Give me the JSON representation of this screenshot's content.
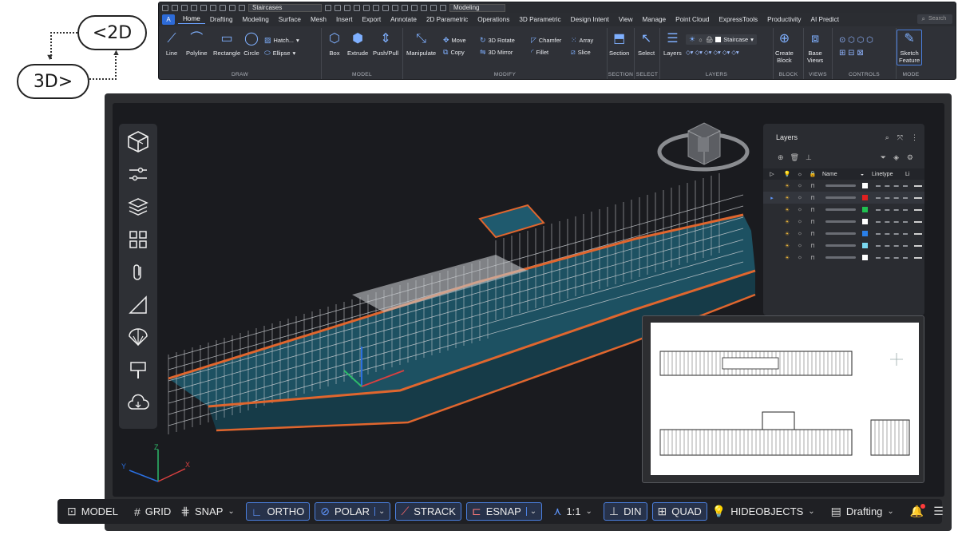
{
  "callouts": {
    "to2d": "<2D",
    "to3d": "3D>"
  },
  "qat": {
    "file_name": "Staircases",
    "workspace": "Modeling"
  },
  "menu": {
    "app": "A",
    "tabs": [
      "Home",
      "Drafting",
      "Modeling",
      "Surface",
      "Mesh",
      "Insert",
      "Export",
      "Annotate",
      "2D Parametric",
      "Operations",
      "3D Parametric",
      "Design Intent",
      "View",
      "Manage",
      "Point Cloud",
      "ExpressTools",
      "Productivity",
      "AI Predict"
    ],
    "active_tab": "Home",
    "search_placeholder": "Search"
  },
  "ribbon": {
    "draw": {
      "title": "DRAW",
      "line": "Line",
      "polyline": "Polyline",
      "rectangle": "Rectangle",
      "circle": "Circle",
      "hatch": "Hatch...",
      "ellipse": "Ellipse"
    },
    "model": {
      "title": "MODEL",
      "box": "Box",
      "extrude": "Extrude",
      "pushpull": "Push/Pull"
    },
    "modify": {
      "title": "MODIFY",
      "manipulate": "Manipulate",
      "move": "Move",
      "copy": "Copy",
      "rotate3d": "3D Rotate",
      "mirror3d": "3D Mirror",
      "chamfer": "Chamfer",
      "fillet": "Fillet",
      "array": "Array",
      "slice": "Slice"
    },
    "section": {
      "title": "SECTION",
      "label": "Section"
    },
    "select": {
      "title": "SELECT",
      "label": "Select"
    },
    "layers": {
      "title": "LAYERS",
      "label": "Layers",
      "current": "Staircase"
    },
    "block": {
      "title": "BLOCK",
      "create1": "Create",
      "create2": "Block"
    },
    "views": {
      "title": "VIEWS",
      "base1": "Base",
      "base2": "Views"
    },
    "controls": {
      "title": "CONTROLS"
    },
    "mode": {
      "title": "MODE",
      "sketch1": "Sketch",
      "sketch2": "Feature"
    }
  },
  "layers_panel": {
    "title": "Layers",
    "columns": {
      "name": "Name",
      "linetype": "Linetype",
      "lineweight": "Li"
    },
    "rows": [
      {
        "color": "#ffffff",
        "selected": false
      },
      {
        "color": "#e02020",
        "selected": true
      },
      {
        "color": "#20c050",
        "selected": false
      },
      {
        "color": "#ffffff",
        "selected": false
      },
      {
        "color": "#2a7fe8",
        "selected": false
      },
      {
        "color": "#7ad8f0",
        "selected": false
      },
      {
        "color": "#ffffff",
        "selected": false
      }
    ]
  },
  "axes": {
    "x": "X",
    "y": "Y",
    "z": "Z"
  },
  "status": {
    "model": "MODEL",
    "grid": "GRID",
    "snap": "SNAP",
    "ortho": "ORTHO",
    "polar": "POLAR",
    "strack": "STRACK",
    "esnap": "ESNAP",
    "scale": "1:1",
    "din": "DIN",
    "quad": "QUAD",
    "hideobjects": "HIDEOBJECTS",
    "workspace": "Drafting"
  },
  "colors": {
    "accent": "#4b80e0",
    "scaffold_orange": "#e0662e",
    "deck_teal": "#1f5a6e"
  }
}
